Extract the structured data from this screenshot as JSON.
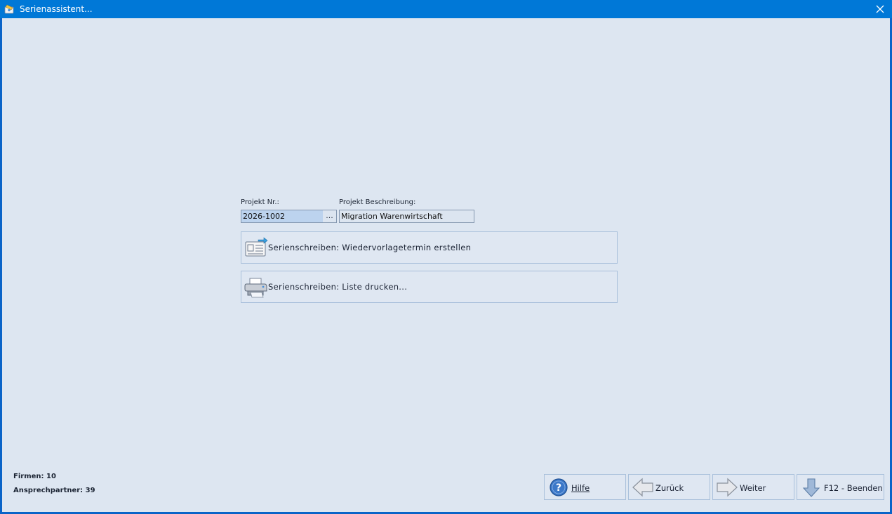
{
  "window": {
    "title": "Serienassistent...",
    "icons": {
      "app": "contacts-app-icon",
      "close": "close-icon"
    }
  },
  "form": {
    "projekt_nr_label": "Projekt Nr.:",
    "projekt_nr_value": "2026-1002",
    "lookup_button_label": "...",
    "projekt_beschreibung_label": "Projekt Beschreibung:",
    "projekt_beschreibung_value": "Migration Warenwirtschaft"
  },
  "actions": [
    {
      "label": "Serienschreiben: Wiedervorlagetermin erstellen",
      "icon": "document-export-icon"
    },
    {
      "label": "Serienschreiben: Liste drucken...",
      "icon": "printer-icon"
    }
  ],
  "stats": {
    "firmen": "Firmen: 10",
    "ansprechpartner": "Ansprechpartner: 39"
  },
  "nav": {
    "hilfe_label": "Hilfe",
    "zurueck_label": "Zurück",
    "weiter_label": "Weiter",
    "beenden_label": "F12 - Beenden"
  },
  "colors": {
    "titlebar": "#0078d7",
    "client_background": "#dde6f1",
    "selected_field": "#bcd3ee",
    "button_border": "#a9c0db"
  }
}
